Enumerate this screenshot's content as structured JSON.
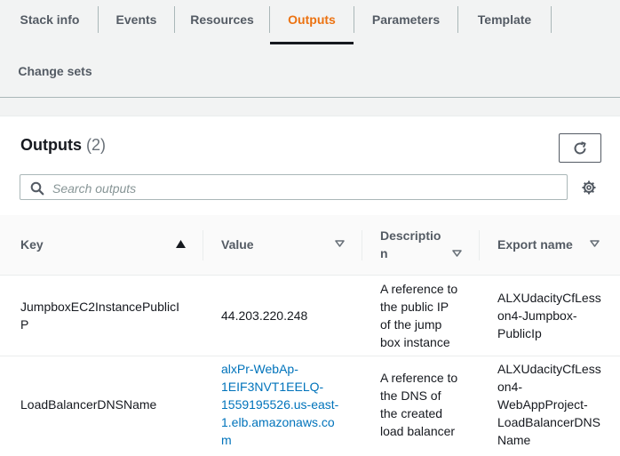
{
  "tabs": [
    {
      "label": "Stack info"
    },
    {
      "label": "Events"
    },
    {
      "label": "Resources"
    },
    {
      "label": "Outputs",
      "active": true
    },
    {
      "label": "Parameters"
    },
    {
      "label": "Template"
    },
    {
      "label": "Change sets"
    }
  ],
  "outputs": {
    "title": "Outputs",
    "count": "(2)",
    "search_placeholder": "Search outputs",
    "columns": {
      "key": "Key",
      "value": "Value",
      "description_line1": "Descriptio",
      "description_line2": "n",
      "export_name": "Export name"
    },
    "sort": {
      "column": "Key",
      "direction": "ascending"
    },
    "rows": [
      {
        "key_line1": "JumpboxEC2InstancePublicI",
        "key_line2": "P",
        "value_line1": "44.203.220.248",
        "value_is_link": false,
        "desc_lines": [
          "A reference to",
          "the public IP",
          "of the jump",
          "box instance"
        ],
        "export_lines": [
          "ALXUdacityCfLess",
          "on4-Jumpbox-",
          "PublicIp"
        ]
      },
      {
        "key_line1": "LoadBalancerDNSName",
        "value_lines": [
          "alxPr-WebAp-",
          "1EIF3NVT1EELQ-",
          "1559195526.us-east-",
          "1.elb.amazonaws.co",
          "m"
        ],
        "value_is_link": true,
        "desc_lines": [
          "A reference to",
          "the DNS of",
          "the created",
          "load balancer"
        ],
        "export_lines": [
          "ALXUdacityCfLess",
          "on4-",
          "WebAppProject-",
          "LoadBalancerDNS",
          "Name"
        ]
      }
    ]
  },
  "colors": {
    "active_tab": "#ec7211",
    "link": "#0073bb",
    "text": "#16191f",
    "muted": "#545b64",
    "background": "#f2f3f3"
  },
  "icons": [
    "refresh-icon",
    "search-icon",
    "gear-icon",
    "sort-ascending-icon",
    "sort-descending-icon"
  ]
}
